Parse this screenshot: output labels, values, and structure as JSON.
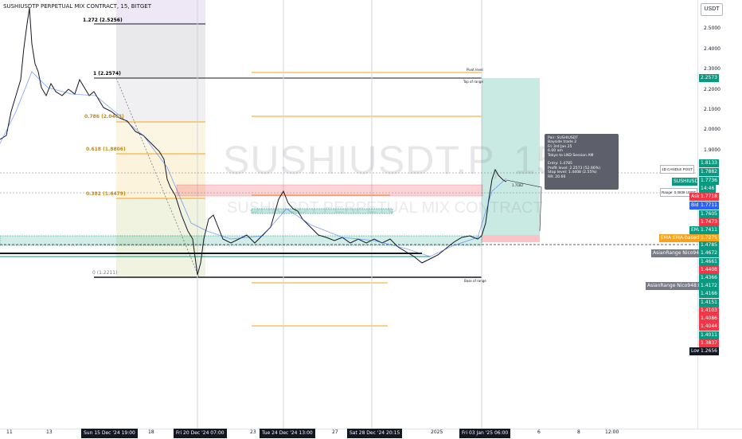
{
  "header": {
    "title": "SUSHIUSDTP PERPETUAL MIX CONTRACT, 15, BITGET"
  },
  "watermark": {
    "symbol": "SUSHIUSDT.P, 15",
    "subtitle": "SUSHIUSDT PERPETUAL MIX CONTRACT"
  },
  "price_axis": {
    "currency_button": "USDT",
    "ticks": [
      "2.5000",
      "2.4000",
      "2.3000",
      "2.2000",
      "2.1000",
      "2.0000",
      "1.9000"
    ],
    "labels": [
      {
        "text": "2.2573",
        "color": "#089981"
      },
      {
        "text": "1.8133",
        "color": "#089981"
      },
      {
        "text": "1.7882",
        "color": "#089981"
      },
      {
        "text": "1.7736",
        "color": "#089981"
      },
      {
        "text": "14:46",
        "color": "#089981"
      },
      {
        "text": "1.7718",
        "color": "#f23645",
        "tag": "Ask"
      },
      {
        "text": "1.7711",
        "color": "#2962ff",
        "tag": "Bid"
      },
      {
        "text": "1.7605",
        "color": "#089981"
      },
      {
        "text": "1.7473",
        "color": "#f23645"
      },
      {
        "text": "1.7411",
        "color": "#089981",
        "tag": "EMA"
      },
      {
        "text": "1.7275",
        "color": "#f7a21b",
        "tag": "EMA EMA-based MA"
      },
      {
        "text": "1.4785",
        "color": "#089981"
      },
      {
        "text": "1.4672",
        "color": "#089981",
        "tag": "AsianRange Nico948:Up"
      },
      {
        "text": "1.4661",
        "color": "#089981"
      },
      {
        "text": "1.4408",
        "color": "#f23645"
      },
      {
        "text": "1.4366",
        "color": "#089981"
      },
      {
        "text": "1.4172",
        "color": "#089981",
        "tag": "AsianRange Nico948:Down"
      },
      {
        "text": "1.4166",
        "color": "#089981"
      },
      {
        "text": "1.4151",
        "color": "#089981"
      },
      {
        "text": "1.4103",
        "color": "#f23645"
      },
      {
        "text": "1.4086",
        "color": "#f23645"
      },
      {
        "text": "1.4044",
        "color": "#f23645"
      },
      {
        "text": "1.4011",
        "color": "#089981"
      },
      {
        "text": "1.3837",
        "color": "#f23645"
      },
      {
        "text": "1.2656",
        "color": "#131722",
        "tag": "Low"
      }
    ]
  },
  "time_axis": {
    "ticks": [
      "11",
      "13",
      "18",
      "23",
      "27",
      "2025",
      "6",
      "8",
      "12:00"
    ],
    "labels": [
      "Sun 15 Dec '24   19:00",
      "Fri 20 Dec '24   07:00",
      "Tue 24 Dec '24   13:00",
      "Sat 28 Dec '24   20:15",
      "Fri 03 Jan '25   06:00"
    ]
  },
  "fib_levels": [
    {
      "label": "1.272 (2.5256)",
      "color": "#131722"
    },
    {
      "label": "1 (2.2574)",
      "color": "#131722"
    },
    {
      "label": "0.786 (2.0463)",
      "color": "#f7a21b"
    },
    {
      "label": "0.618 (1.8806)",
      "color": "#f7a21b"
    },
    {
      "label": "0.382 (1.6479)",
      "color": "#f7a21b"
    },
    {
      "label": "0 (1.2211)",
      "color": "#787b86"
    }
  ],
  "annotations": {
    "pivot_level": "Pivot level",
    "top_of_range": "Top of range",
    "base_of_range": "Base of range",
    "candle_post": "1D CANDLE POST",
    "range": "Range: 0.0838 USDT",
    "symbol_tag": "SUSHIUSDT.P",
    "hover_value": "1.7182"
  },
  "trade_info": {
    "lines": [
      "Pair: SUSHIUSDT",
      "Bayside trade 2",
      "Fri 3rd Jan 25",
      "6.00 am",
      "Tokyo to LND Session AM",
      "",
      "Entry: 1.4785",
      "Profit level: 2.2573 (52.66%)",
      "Stop level: 1.4408 (2.55%)",
      "RR: 20.66"
    ]
  },
  "colors": {
    "up": "#089981",
    "down": "#f23645",
    "accent": "#2962ff",
    "fib": "#f7a21b"
  }
}
